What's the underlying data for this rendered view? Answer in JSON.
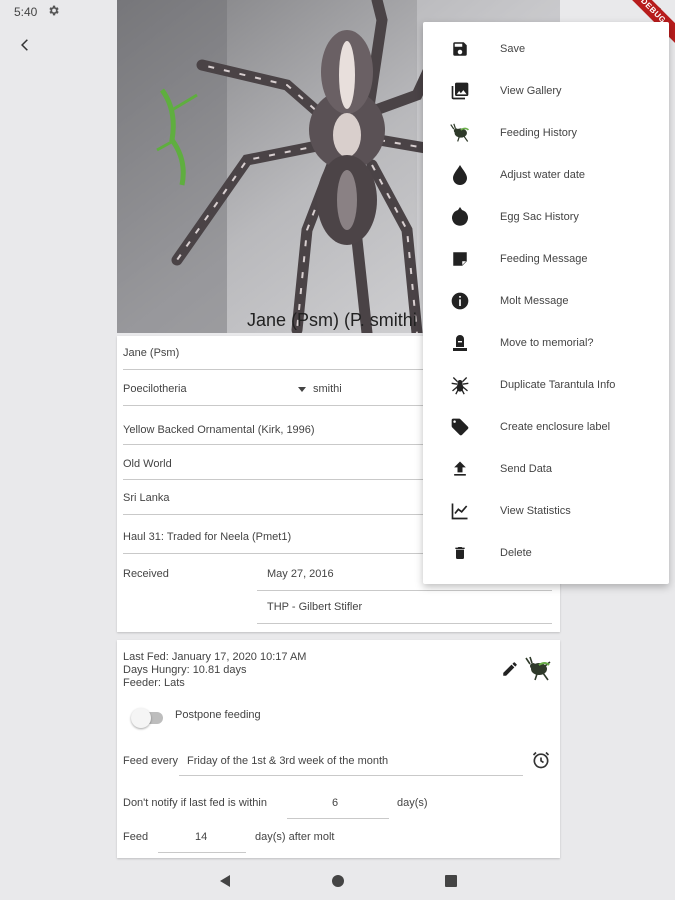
{
  "status_bar": {
    "time": "5:40"
  },
  "debug_banner": "DEBUG",
  "photo": {
    "caption": "Jane (Psm) (P. smithi"
  },
  "details": {
    "name": "Jane (Psm)",
    "genus": "Poecilotheria",
    "species": "smithi",
    "common_name": "Yellow Backed Ornamental (Kirk, 1996)",
    "world": "Old World",
    "origin": "Sri Lanka",
    "note": "Haul 31: Traded for Neela (Pmet1)",
    "received_label": "Received",
    "received_date": "May 27, 2016",
    "received_from": "THP - Gilbert Stifler"
  },
  "feeding": {
    "last_fed": "Last Fed: January 17, 2020 10:17 AM",
    "days_hungry": "Days Hungry: 10.81 days",
    "feeder": "Feeder: Lats",
    "postpone_label": "Postpone feeding",
    "feed_every_label": "Feed every",
    "feed_every_value": "Friday of the 1st & 3rd week of the month",
    "dont_notify_label": "Don't notify if last fed is within",
    "dont_notify_value": "6",
    "dont_notify_unit": "day(s)",
    "feed_label": "Feed",
    "feed_value": "14",
    "feed_unit": "day(s) after molt"
  },
  "menu": {
    "items": [
      {
        "label": "Save",
        "icon": "save-icon"
      },
      {
        "label": "View Gallery",
        "icon": "gallery-icon"
      },
      {
        "label": "Feeding History",
        "icon": "cricket-icon"
      },
      {
        "label": "Adjust water date",
        "icon": "water-drop-icon"
      },
      {
        "label": "Egg Sac History",
        "icon": "egg-sac-icon"
      },
      {
        "label": "Feeding Message",
        "icon": "note-icon"
      },
      {
        "label": "Molt Message",
        "icon": "info-icon"
      },
      {
        "label": "Move to memorial?",
        "icon": "memorial-icon"
      },
      {
        "label": "Duplicate Tarantula Info",
        "icon": "spider-icon"
      },
      {
        "label": "Create enclosure label",
        "icon": "tag-icon"
      },
      {
        "label": "Send Data",
        "icon": "upload-icon"
      },
      {
        "label": "View Statistics",
        "icon": "chart-icon"
      },
      {
        "label": "Delete",
        "icon": "trash-icon"
      }
    ]
  }
}
